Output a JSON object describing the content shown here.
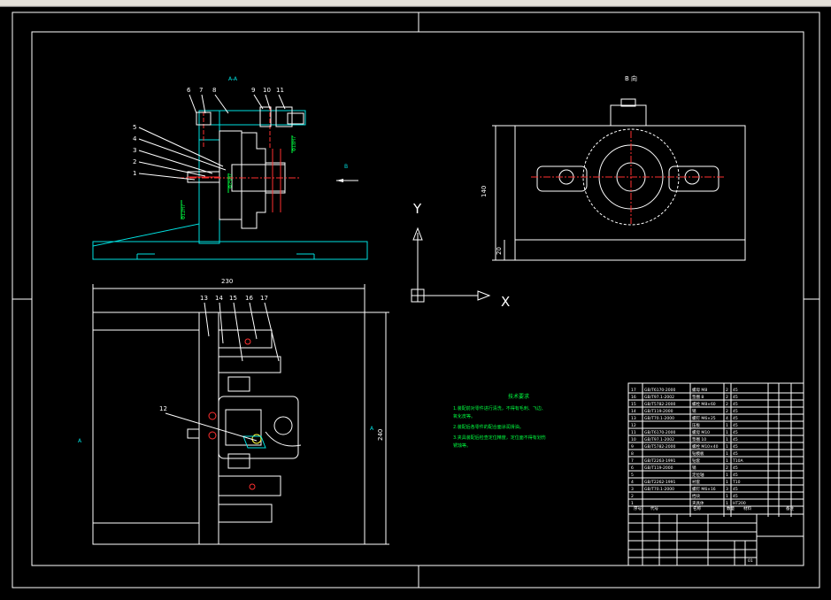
{
  "toolbar": {
    "segments": 6
  },
  "views": {
    "top_left_label": "A-A",
    "right_view_label": "B 向",
    "b_arrow_label": "B",
    "a_label_left": "A",
    "a_label_right": "A"
  },
  "dimensions": {
    "width_230": "230",
    "height_240": "240",
    "height_140": "140",
    "height_20": "20",
    "dia_label_1": "Φ25H7",
    "dia_label_2": "Φ18H7",
    "dia_label_3": "Φ12H7"
  },
  "ucs": {
    "y": "Y",
    "x": "X"
  },
  "balloons": {
    "top": [
      "6",
      "7",
      "8",
      "9",
      "10",
      "11"
    ],
    "left": [
      "5",
      "4",
      "3",
      "2",
      "1"
    ],
    "bottom": [
      "13",
      "14",
      "15",
      "16",
      "17"
    ],
    "twelve": "12"
  },
  "notes": {
    "title": "技术要求",
    "lines": [
      "1.装配前对零件进行清洗，不得有毛刺、飞边、",
      "  氧化皮等。",
      "2.装配后各零件的配合面涂润滑油。",
      "3.夹具装配后检查定位精度，定位面不得有划伤",
      "  锈蚀等。"
    ]
  },
  "bom": {
    "rows": [
      [
        "17",
        "GB/T6170-2000",
        "螺母 M8",
        "2",
        "45",
        ""
      ],
      [
        "16",
        "GB/T97.1-2002",
        "垫圈 8",
        "2",
        "45",
        ""
      ],
      [
        "15",
        "GB/T5782-2000",
        "螺栓 M8×60",
        "2",
        "45",
        ""
      ],
      [
        "14",
        "GB/T119-2000",
        "销",
        "2",
        "45",
        ""
      ],
      [
        "13",
        "GB/T70.1-2000",
        "螺钉 M6×25",
        "4",
        "45",
        ""
      ],
      [
        "12",
        "",
        "压板",
        "1",
        "45",
        ""
      ],
      [
        "11",
        "GB/T6170-2000",
        "螺母 M10",
        "1",
        "45",
        ""
      ],
      [
        "10",
        "GB/T97.1-2002",
        "垫圈 10",
        "1",
        "45",
        ""
      ],
      [
        "9",
        "GB/T5782-2000",
        "螺栓 M10×40",
        "1",
        "45",
        ""
      ],
      [
        "8",
        "",
        "钻模板",
        "1",
        "45",
        ""
      ],
      [
        "7",
        "GB/T2263-1991",
        "钻套",
        "1",
        "T10A",
        ""
      ],
      [
        "6",
        "GB/T119-2000",
        "销",
        "2",
        "45",
        ""
      ],
      [
        "5",
        "",
        "定位轴",
        "1",
        "45",
        ""
      ],
      [
        "4",
        "GB/T2262-1991",
        "衬套",
        "1",
        "T10",
        ""
      ],
      [
        "3",
        "GB/T70.1-2000",
        "螺钉 M6×16",
        "3",
        "45",
        ""
      ],
      [
        "2",
        "",
        "挡块",
        "1",
        "45",
        ""
      ],
      [
        "1",
        "",
        "夹具体",
        "1",
        "HT200",
        ""
      ]
    ],
    "header": [
      "序号",
      "代号",
      "名称",
      "数量",
      "材料",
      "备注"
    ],
    "title_code": "01"
  }
}
